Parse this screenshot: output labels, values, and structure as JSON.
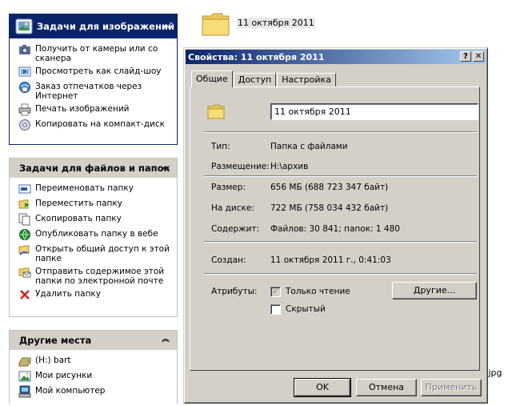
{
  "image_tasks": {
    "title": "Задачи для изображений",
    "items": [
      {
        "label": "Получить от камеры или со сканера",
        "icon": "camera-icon"
      },
      {
        "label": "Просмотреть как слайд-шоу",
        "icon": "slideshow-icon"
      },
      {
        "label": "Заказ отпечатков через Интернет",
        "icon": "order-prints-icon"
      },
      {
        "label": "Печать изображений",
        "icon": "printer-icon"
      },
      {
        "label": "Копировать на компакт-диск",
        "icon": "cd-icon"
      }
    ]
  },
  "file_tasks": {
    "title": "Задачи для файлов и папок",
    "items": [
      {
        "label": "Переименовать папку",
        "icon": "rename-icon"
      },
      {
        "label": "Переместить папку",
        "icon": "move-icon"
      },
      {
        "label": "Скопировать папку",
        "icon": "copy-icon"
      },
      {
        "label": "Опубликовать папку в вебе",
        "icon": "publish-web-icon"
      },
      {
        "label": "Открыть общий доступ к этой папке",
        "icon": "share-icon"
      },
      {
        "label": "Отправить содержимое этой папки по электронной почте",
        "icon": "email-icon"
      },
      {
        "label": "Удалить папку",
        "icon": "delete-icon"
      }
    ]
  },
  "other_places": {
    "title": "Другие места",
    "items": [
      {
        "label": "(H:) bart",
        "icon": "drive-icon"
      },
      {
        "label": "Мои рисунки",
        "icon": "pictures-icon"
      },
      {
        "label": "Мой компьютер",
        "icon": "computer-icon"
      }
    ]
  },
  "folder": {
    "label": "11 октября 2011",
    "file_label": ".jpg"
  },
  "dialog": {
    "title": "Свойства: 11 октября 2011",
    "help_btn": "?",
    "close_btn": "✕",
    "tabs": [
      "Общие",
      "Доступ",
      "Настройка"
    ],
    "name_value": "11 октября 2011",
    "type_label": "Тип:",
    "type_value": "Папка с файлами",
    "location_label": "Размещение:",
    "location_value": "H:\\архив",
    "size_label": "Размер:",
    "size_value": "656 МБ (688 723 347 байт)",
    "disk_label": "На диске:",
    "disk_value": "722 МБ (758 034 432 байт)",
    "contains_label": "Содержит:",
    "contains_value": "Файлов: 30 841; папок: 1 480",
    "created_label": "Создан:",
    "created_value": "11 октября 2011 г., 0:41:03",
    "attributes_label": "Атрибуты:",
    "readonly_label": "Только чтение",
    "hidden_label": "Скрытый",
    "other_button": "Другие...",
    "ok_button": "OK",
    "cancel_button": "Отмена",
    "apply_button": "Применить"
  },
  "colors": {
    "selection": "#0a246a",
    "dialog_face": "#d4d0c8",
    "title_gradient_end": "#a6caf0"
  }
}
